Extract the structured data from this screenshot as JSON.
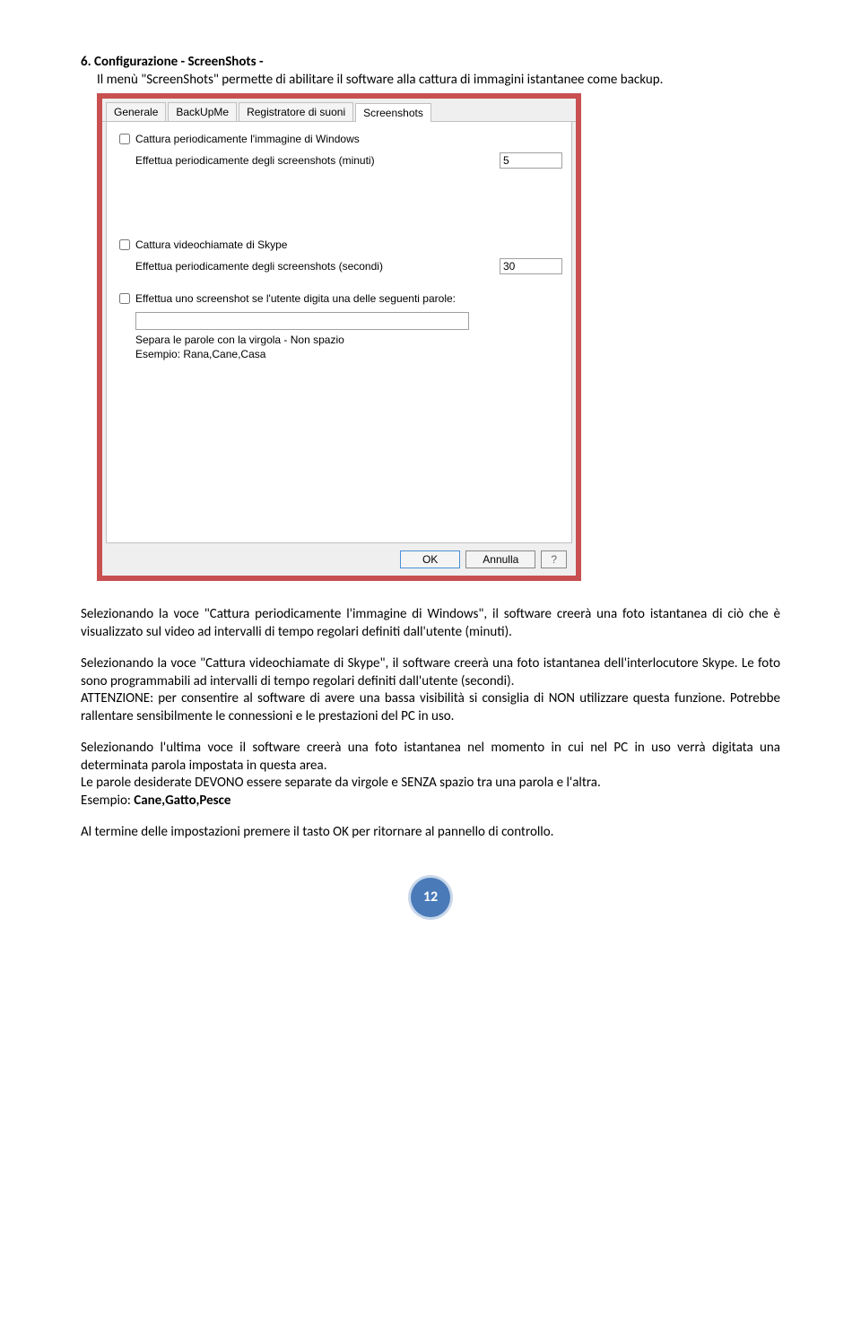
{
  "doc": {
    "heading": "6.    Configurazione - ScreenShots -",
    "subheading": "Il menù \"ScreenShots\" permette di abilitare il software alla cattura di immagini istantanee come backup.",
    "page_number": "12"
  },
  "screenshot": {
    "tabs": {
      "generale": "Generale",
      "backupme": "BackUpMe",
      "registratore": "Registratore di suoni",
      "screenshots": "Screenshots"
    },
    "cb1": "Cattura periodicamente l'immagine di Windows",
    "row1_label": "Effettua periodicamente degli screenshots (minuti)",
    "row1_value": "5",
    "cb2": "Cattura videochiamate di Skype",
    "row2_label": "Effettua periodicamente degli screenshots (secondi)",
    "row2_value": "30",
    "cb3": "Effettua uno screenshot se l'utente digita una delle seguenti parole:",
    "hint1": "Separa le parole con la virgola - Non spazio",
    "hint2": "Esempio: Rana,Cane,Casa",
    "buttons": {
      "ok": "OK",
      "cancel": "Annulla",
      "help": "?"
    }
  },
  "body": {
    "p1": "Selezionando la voce \"Cattura periodicamente l'immagine di Windows\", il software creerà una foto istantanea di ciò che è visualizzato sul video ad intervalli di tempo regolari definiti dall'utente (minuti).",
    "p2a": "Selezionando la voce \"Cattura videochiamate di Skype\", il software creerà una foto istantanea dell'interlocutore Skype. Le foto sono programmabili ad intervalli di tempo regolari definiti dall'utente (secondi).",
    "p2b": "ATTENZIONE: per consentire al software di avere una bassa visibilità si consiglia di NON utilizzare questa funzione. Potrebbe rallentare sensibilmente le connessioni e le prestazioni del PC in uso.",
    "p3a": "Selezionando l'ultima voce il software creerà una foto istantanea nel momento in cui nel PC in uso verrà digitata una determinata parola impostata in questa area.",
    "p3b": "Le parole desiderate DEVONO essere separate da virgole e SENZA spazio tra una parola e l'altra.",
    "p3c_label": "Esempio:  ",
    "p3c_bold": "Cane,Gatto,Pesce",
    "p4": "Al termine delle impostazioni premere il tasto OK per ritornare al pannello di controllo."
  }
}
